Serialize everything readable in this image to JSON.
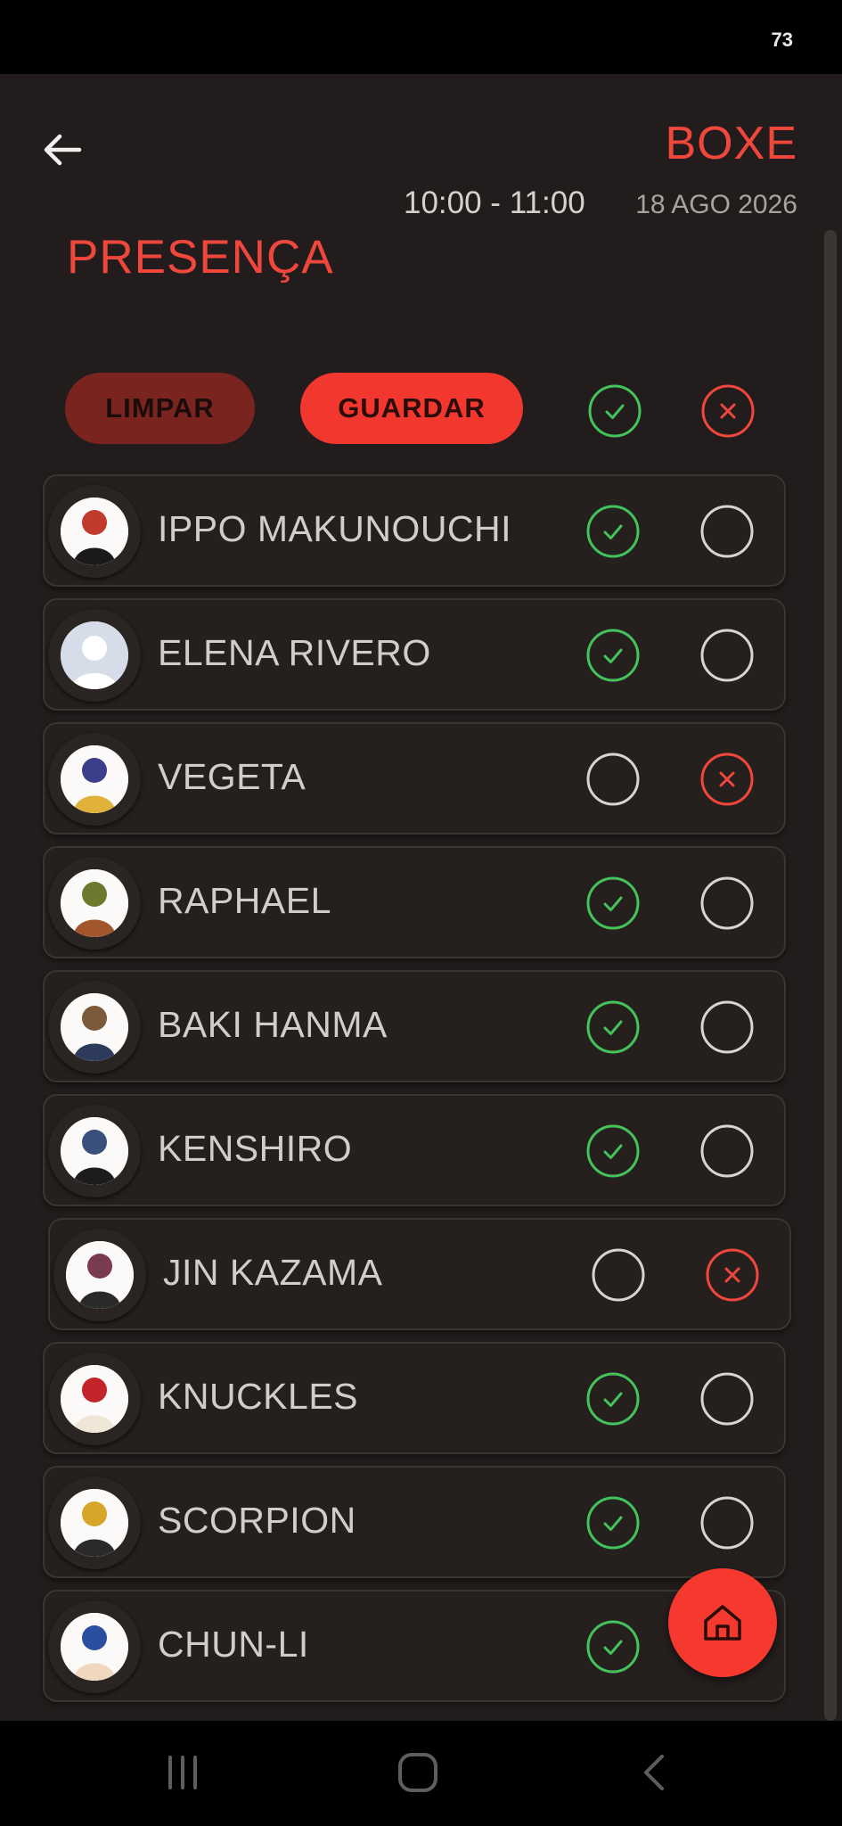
{
  "status_bar": {
    "battery": "73"
  },
  "header": {
    "app_title": "BOXE",
    "time_range": "10:00 - 11:00",
    "date": "18 AGO 2026",
    "page_title": "PRESENÇA"
  },
  "actions": {
    "clear_label": "LIMPAR",
    "save_label": "GUARDAR"
  },
  "colors": {
    "accent": "#f0473d",
    "present": "#43c35a",
    "absent": "#f0473d",
    "background": "#221d1c"
  },
  "students": [
    {
      "name": "IPPO MAKUNOUCHI",
      "present": true
    },
    {
      "name": "ELENA RIVERO",
      "present": true
    },
    {
      "name": "VEGETA",
      "present": false
    },
    {
      "name": "RAPHAEL",
      "present": true
    },
    {
      "name": "BAKI HANMA",
      "present": true
    },
    {
      "name": "KENSHIRO",
      "present": true
    },
    {
      "name": "JIN KAZAMA",
      "present": false
    },
    {
      "name": "KNUCKLES",
      "present": true
    },
    {
      "name": "SCORPION",
      "present": true
    },
    {
      "name": "CHUN-LI",
      "present": true
    }
  ],
  "icons": {
    "back": "arrow-left-icon",
    "home": "home-icon",
    "recent": "recent-apps-icon",
    "home_nav": "home-nav-icon",
    "back_nav": "back-nav-icon"
  }
}
